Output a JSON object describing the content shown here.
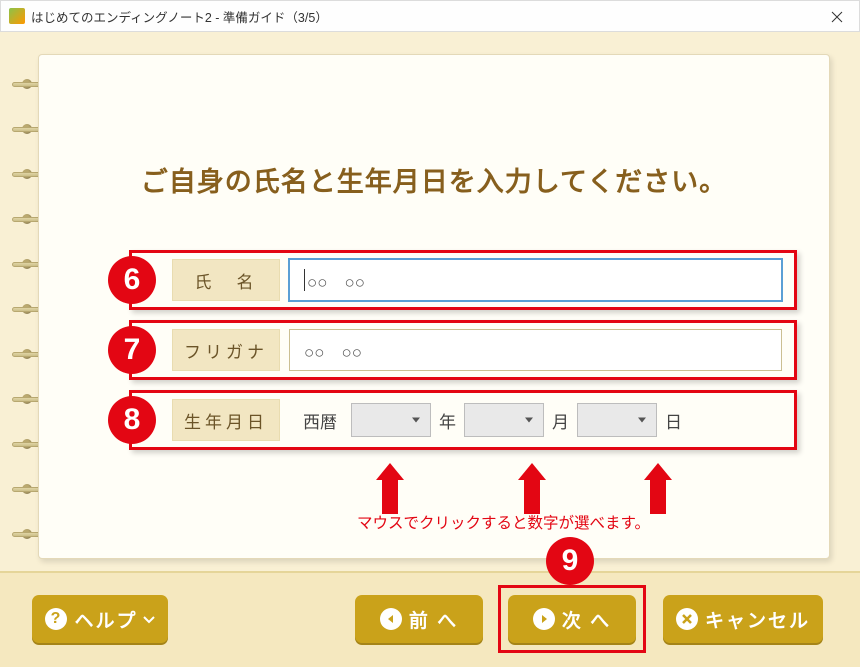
{
  "window": {
    "title": "はじめてのエンディングノート2 - 準備ガイド（3/5）"
  },
  "heading": "ご自身の氏名と生年月日を入力してください。",
  "badges": {
    "r6": "6",
    "r7": "7",
    "r8": "8",
    "r9": "9"
  },
  "fields": {
    "name_label": "氏　名",
    "name_value": "○○　○○",
    "kana_label": "フリガナ",
    "kana_value": "○○　○○",
    "dob_label": "生年月日",
    "era": "西暦",
    "year_unit": "年",
    "month_unit": "月",
    "day_unit": "日"
  },
  "hint": "マウスでクリックすると数字が選べます。",
  "buttons": {
    "help": "ヘルプ",
    "prev": "前 へ",
    "next": "次 へ",
    "cancel": "キャンセル"
  }
}
